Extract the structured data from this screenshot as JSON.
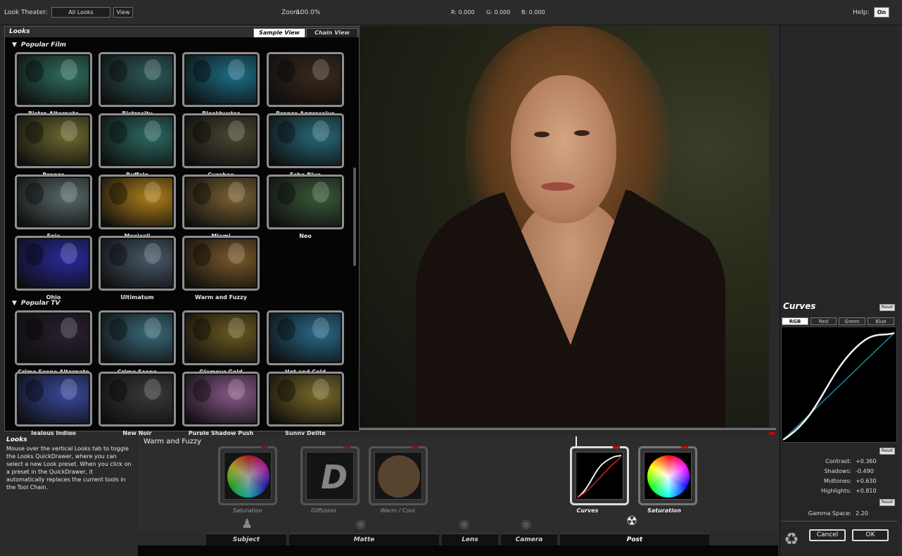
{
  "topbar": {
    "theater_label": "Look Theater:",
    "all_looks": "All Looks",
    "view_btn": "View",
    "zoom_label": "Zoom:",
    "zoom_value": "100.0%",
    "r": "R: 0.000",
    "g": "G: 0.000",
    "b": "B: 0.000",
    "help_label": "Help:",
    "help_toggle": "On"
  },
  "looks": {
    "header": "Looks",
    "tab_sample": "Sample View",
    "tab_chain": "Chain View",
    "sections": [
      {
        "title": "Popular Film",
        "items": [
          {
            "label": "Bistro Alternate",
            "tint": "#2f6f5f"
          },
          {
            "label": "Bistrocity",
            "tint": "#2e5a5a"
          },
          {
            "label": "Blockbuster",
            "tint": "#1d6f88"
          },
          {
            "label": "Bronze Aggressive",
            "tint": "#3b2a1e"
          },
          {
            "label": "Bronze",
            "tint": "#6e6a30"
          },
          {
            "label": "Buffalo",
            "tint": "#2e6a62"
          },
          {
            "label": "Curahee",
            "tint": "#4b4632"
          },
          {
            "label": "Echo Blue",
            "tint": "#2a6a7a"
          },
          {
            "label": "Epic",
            "tint": "#5a6a6a"
          },
          {
            "label": "Mexicali",
            "tint": "#b0801a"
          },
          {
            "label": "Miami",
            "tint": "#7a6232"
          },
          {
            "label": "Neo",
            "tint": "#3a5a3a"
          },
          {
            "label": "Ohio",
            "tint": "#2a2aa0"
          },
          {
            "label": "Ultimatum",
            "tint": "#4a5a6a"
          },
          {
            "label": "Warm and Fuzzy",
            "tint": "#7a5a2a"
          }
        ]
      },
      {
        "title": "Popular TV",
        "items": [
          {
            "label": "Crime Scene Alternate",
            "tint": "#2a2030"
          },
          {
            "label": "Crime Scene",
            "tint": "#3a6a7a"
          },
          {
            "label": "Glamour Gold",
            "tint": "#6a5a20"
          },
          {
            "label": "Hot and Cold",
            "tint": "#2a6a8a"
          },
          {
            "label": "Jealous Indigo",
            "tint": "#3a4aa0"
          },
          {
            "label": "New Noir",
            "tint": "#3a3a3a"
          },
          {
            "label": "Purple Shadow Push",
            "tint": "#8a5a8a"
          },
          {
            "label": "Sunny Delite",
            "tint": "#7a6a2a"
          }
        ]
      }
    ]
  },
  "curves": {
    "title": "Curves",
    "reset": "Reset",
    "channels": [
      "RGB",
      "Red",
      "Green",
      "Blue"
    ],
    "stats": [
      {
        "label": "Contrast:",
        "value": "+0.360"
      },
      {
        "label": "Shadows:",
        "value": "-0.490"
      },
      {
        "label": "Midtones:",
        "value": "+0.630"
      },
      {
        "label": "Highlights:",
        "value": "+0.810"
      }
    ],
    "gamma_label": "Gamma Space:",
    "gamma_value": "2.20",
    "cancel": "Cancel",
    "ok": "OK"
  },
  "info": {
    "title": "Looks",
    "body": "Mouse over the vertical Looks tab to toggle the Looks QuickDrawer, where you can select a new Look preset. When you click on a preset in the QuickDrawer, it automatically replaces the current tools in the Tool Chain."
  },
  "chain": {
    "title": "Warm and Fuzzy",
    "tools": [
      {
        "label": "Saturation",
        "active": false
      },
      {
        "label": "Diffusion",
        "active": false
      },
      {
        "label": "Warm / Cool",
        "active": false
      },
      {
        "label": "Curves",
        "active": true
      },
      {
        "label": "Saturation",
        "active": true
      }
    ],
    "categories": [
      "Subject",
      "Matte",
      "Lens",
      "Camera",
      "Post"
    ]
  }
}
